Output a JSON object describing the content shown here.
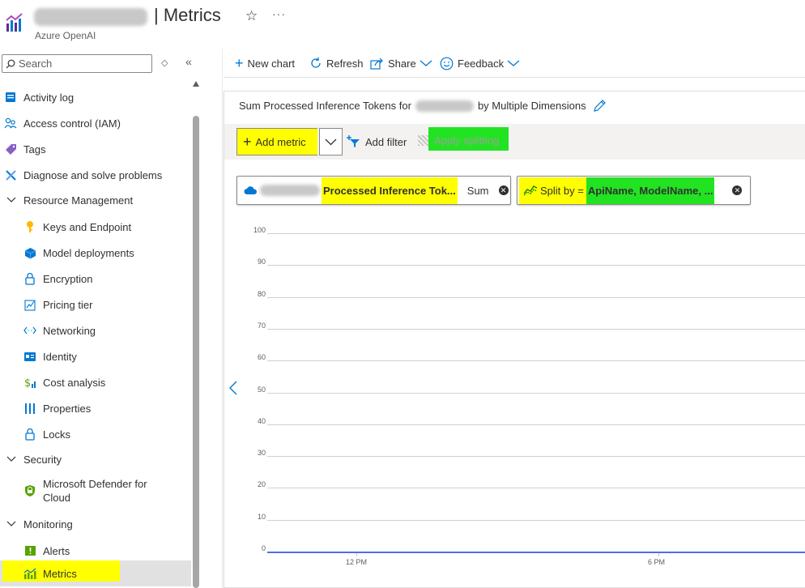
{
  "header": {
    "title": "| Metrics",
    "subtitle": "Azure OpenAI",
    "star_icon": "star-icon",
    "more_label": "···"
  },
  "sidebar": {
    "search_placeholder": "Search",
    "collapse_label": "«",
    "items": [
      {
        "label": "Activity log",
        "icon": "activity-log-icon",
        "indent": 0
      },
      {
        "label": "Access control (IAM)",
        "icon": "people-icon",
        "indent": 0
      },
      {
        "label": "Tags",
        "icon": "tag-icon",
        "indent": 0
      },
      {
        "label": "Diagnose and solve problems",
        "icon": "wrench-icon",
        "indent": 0
      },
      {
        "label": "Resource Management",
        "icon": "chevron-down-icon",
        "indent": 0
      },
      {
        "label": "Keys and Endpoint",
        "icon": "key-icon",
        "indent": 1
      },
      {
        "label": "Model deployments",
        "icon": "cube-icon",
        "indent": 1
      },
      {
        "label": "Encryption",
        "icon": "lock-icon",
        "indent": 1
      },
      {
        "label": "Pricing tier",
        "icon": "pricing-icon",
        "indent": 1
      },
      {
        "label": "Networking",
        "icon": "networking-icon",
        "indent": 1
      },
      {
        "label": "Identity",
        "icon": "identity-icon",
        "indent": 1
      },
      {
        "label": "Cost analysis",
        "icon": "cost-icon",
        "indent": 1
      },
      {
        "label": "Properties",
        "icon": "properties-icon",
        "indent": 1
      },
      {
        "label": "Locks",
        "icon": "lock-icon",
        "indent": 1
      },
      {
        "label": "Security",
        "icon": "chevron-down-icon",
        "indent": 0
      },
      {
        "label": "Microsoft Defender for",
        "label2": "Cloud",
        "icon": "shield-icon",
        "indent": 1
      },
      {
        "label": "Monitoring",
        "icon": "chevron-down-icon",
        "indent": 0
      },
      {
        "label": "Alerts",
        "icon": "alert-icon",
        "indent": 1
      },
      {
        "label": "Metrics",
        "icon": "metrics-icon",
        "indent": 1,
        "selected": true
      }
    ]
  },
  "toolbar": {
    "new_chart": "New chart",
    "refresh": "Refresh",
    "share": "Share",
    "feedback": "Feedback"
  },
  "chart_card": {
    "title": "Sum Processed Inference Tokens for",
    "title_suffix": "by Multiple Dimensions",
    "add_metric": "Add metric",
    "add_filter": "Add filter",
    "apply_splitting": "Apply splitting",
    "metric_pill": {
      "name": "Processed Inference Tok...",
      "agg": "Sum"
    },
    "split_pill": {
      "label": "Split by =",
      "value": "ApiName, ModelName, ..."
    }
  },
  "chart_data": {
    "type": "line",
    "y_ticks": [
      "100",
      "90",
      "80",
      "70",
      "60",
      "50",
      "40",
      "30",
      "20",
      "10",
      "0"
    ],
    "x_ticks": [
      "12 PM",
      "6 PM"
    ],
    "ylim": [
      0,
      100
    ],
    "series": [
      {
        "values": [
          0,
          0
        ]
      }
    ]
  },
  "colors": {
    "highlight_yellow": "#ffff00",
    "highlight_green": "#22e322",
    "azure_blue": "#0078d4",
    "series_line": "#4f6bed"
  }
}
